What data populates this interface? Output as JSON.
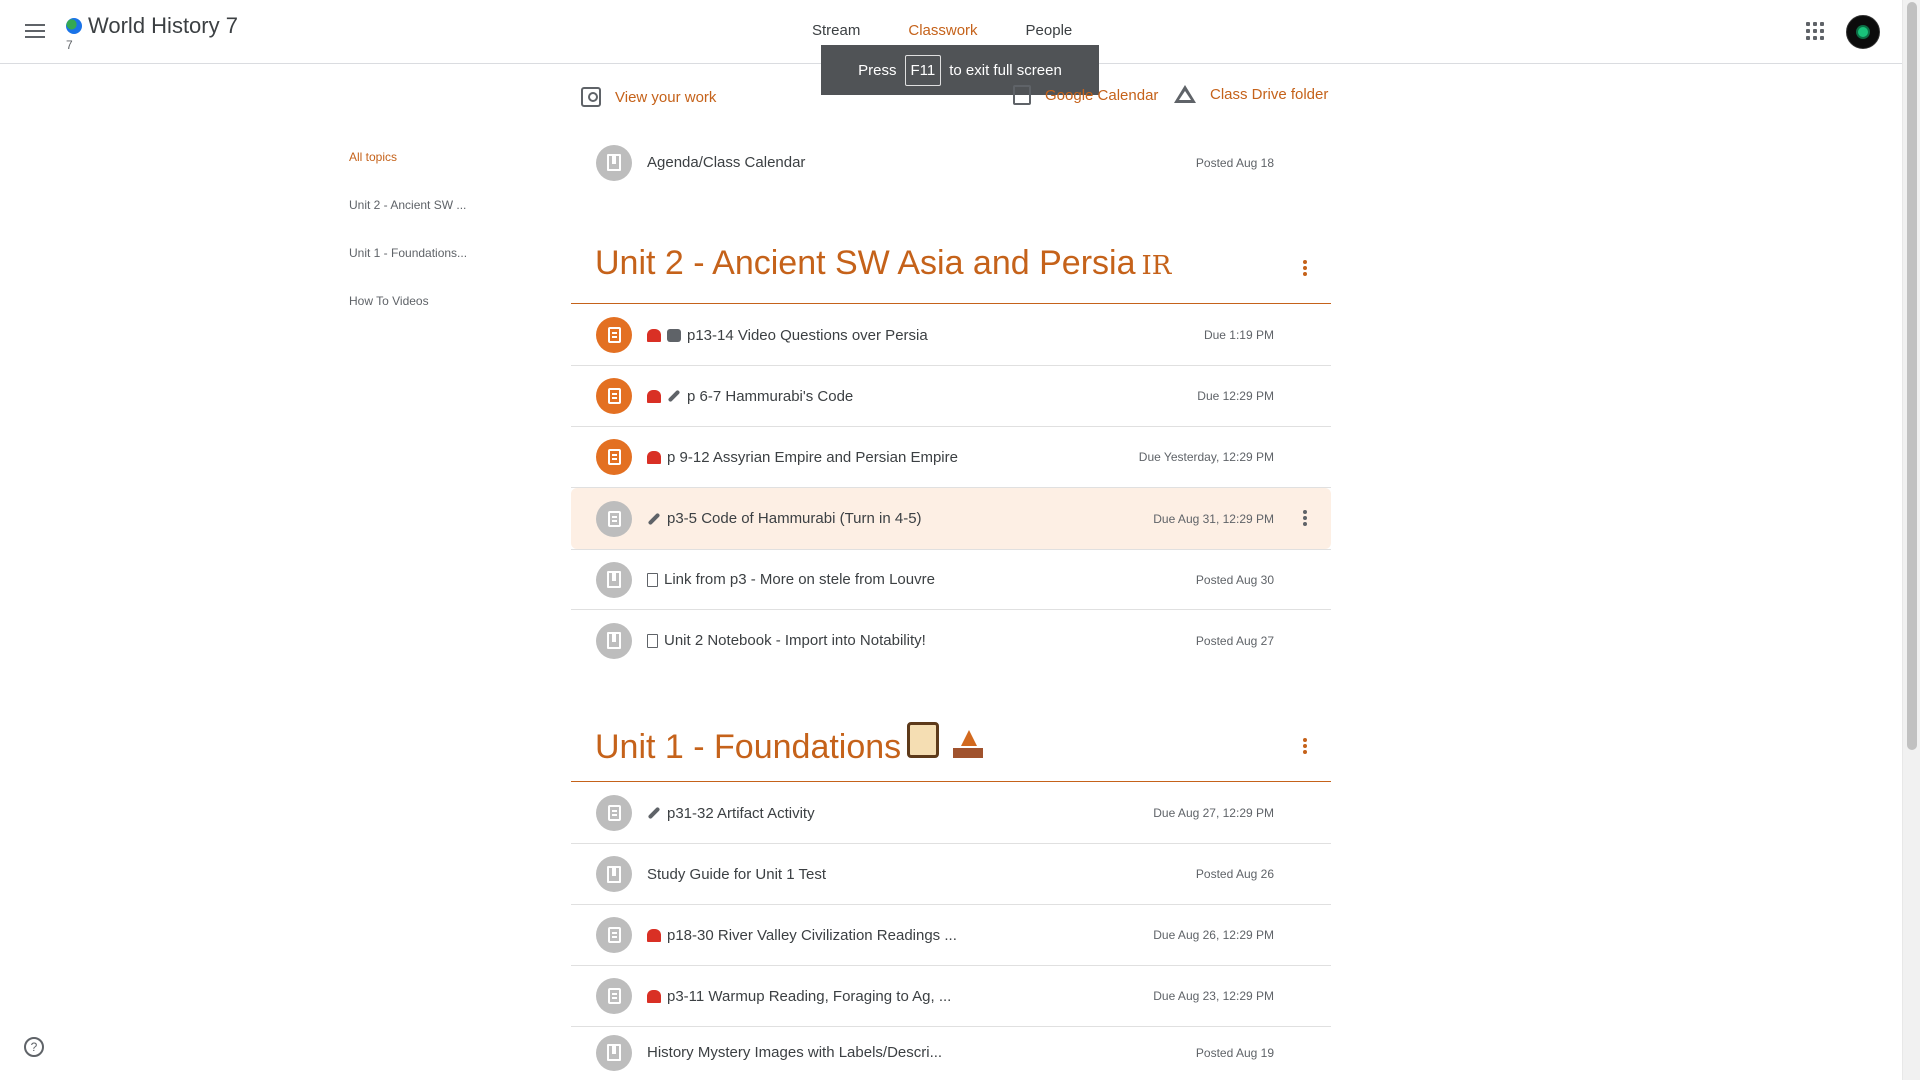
{
  "header": {
    "class_name": "World History 7",
    "section": "7",
    "tabs": [
      {
        "label": "Stream",
        "active": false
      },
      {
        "label": "Classwork",
        "active": true
      },
      {
        "label": "People",
        "active": false
      }
    ],
    "accent_color": "#c5621a"
  },
  "toast": {
    "press": "Press",
    "key": "F11",
    "rest": "to exit full screen"
  },
  "actions": {
    "view_work": "View your work",
    "calendar": "Google Calendar",
    "drive": "Class Drive folder"
  },
  "topics": [
    "All topics",
    "Unit 2 - Ancient SW ...",
    "Unit 1 - Foundations...",
    "How To Videos"
  ],
  "top_item": {
    "title": "Agenda/Class Calendar",
    "date": "Posted Aug 18"
  },
  "unit2": {
    "title": "Unit 2 - Ancient SW Asia and Persia",
    "suffix": "IR",
    "items": [
      {
        "title": "p13-14 Video Questions over Persia",
        "date": "Due 1:19 PM"
      },
      {
        "title": "p 6-7 Hammurabi's Code",
        "date": "Due 12:29 PM"
      },
      {
        "title": "p 9-12 Assyrian Empire and Persian Empire",
        "date": "Due Yesterday, 12:29 PM"
      },
      {
        "title": "p3-5 Code of Hammurabi (Turn in 4-5)",
        "date": "Due Aug 31, 12:29 PM"
      },
      {
        "title": "Link from p3 - More on stele from Louvre",
        "date": "Posted Aug 30"
      },
      {
        "title": "Unit 2 Notebook - Import into Notability!",
        "date": "Posted Aug 27"
      }
    ]
  },
  "unit1": {
    "title": "Unit 1 - Foundations",
    "items": [
      {
        "title": "p31-32 Artifact Activity",
        "date": "Due Aug 27, 12:29 PM"
      },
      {
        "title": "Study Guide for Unit 1 Test",
        "date": "Posted Aug 26"
      },
      {
        "title": "p18-30 River Valley Civilization Readings ...",
        "date": "Due Aug 26, 12:29 PM"
      },
      {
        "title": "p3-11 Warmup Reading, Foraging to Ag, ...",
        "date": "Due Aug 23, 12:29 PM"
      },
      {
        "title": "History Mystery Images with Labels/Descri...",
        "date": "Posted Aug 19"
      }
    ]
  },
  "help": "?"
}
